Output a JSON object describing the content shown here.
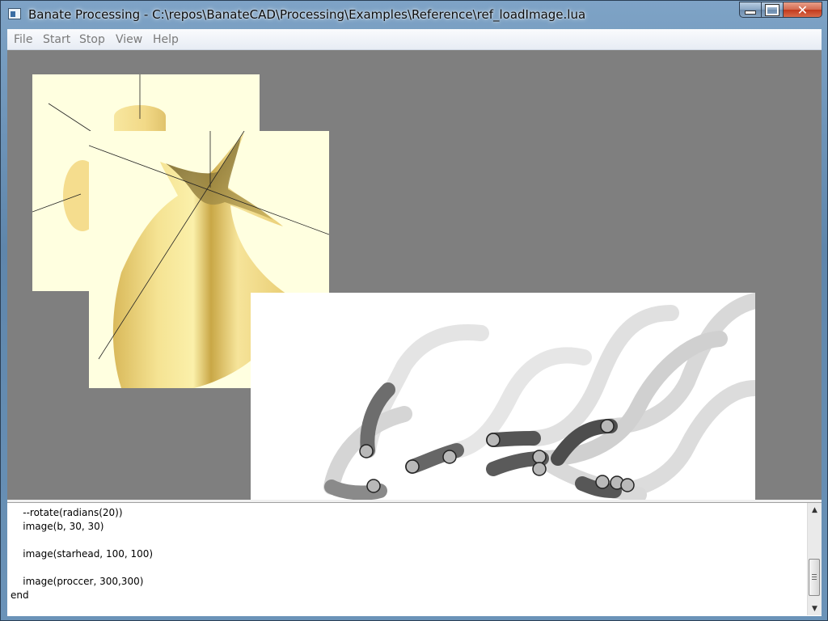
{
  "window": {
    "title": "Banate Processing - C:\\repos\\BanateCAD\\Processing\\Examples\\Reference\\ref_loadImage.lua",
    "close_glyph": "✕"
  },
  "menu": [
    "File",
    "Start",
    "Stop",
    "View",
    "Help"
  ],
  "colors": {
    "canvas_bg": "#7f7f7f",
    "render_bg": "#ffffe0",
    "shape_fill": "#f2df80"
  },
  "editor": {
    "lines": [
      "    --rotate(radians(20))",
      "    image(b, 30, 30)",
      "",
      "    image(starhead, 100, 100)",
      "",
      "    image(proccer, 300,300)",
      "end"
    ],
    "scroll_up": "▲",
    "scroll_down": "▼"
  }
}
